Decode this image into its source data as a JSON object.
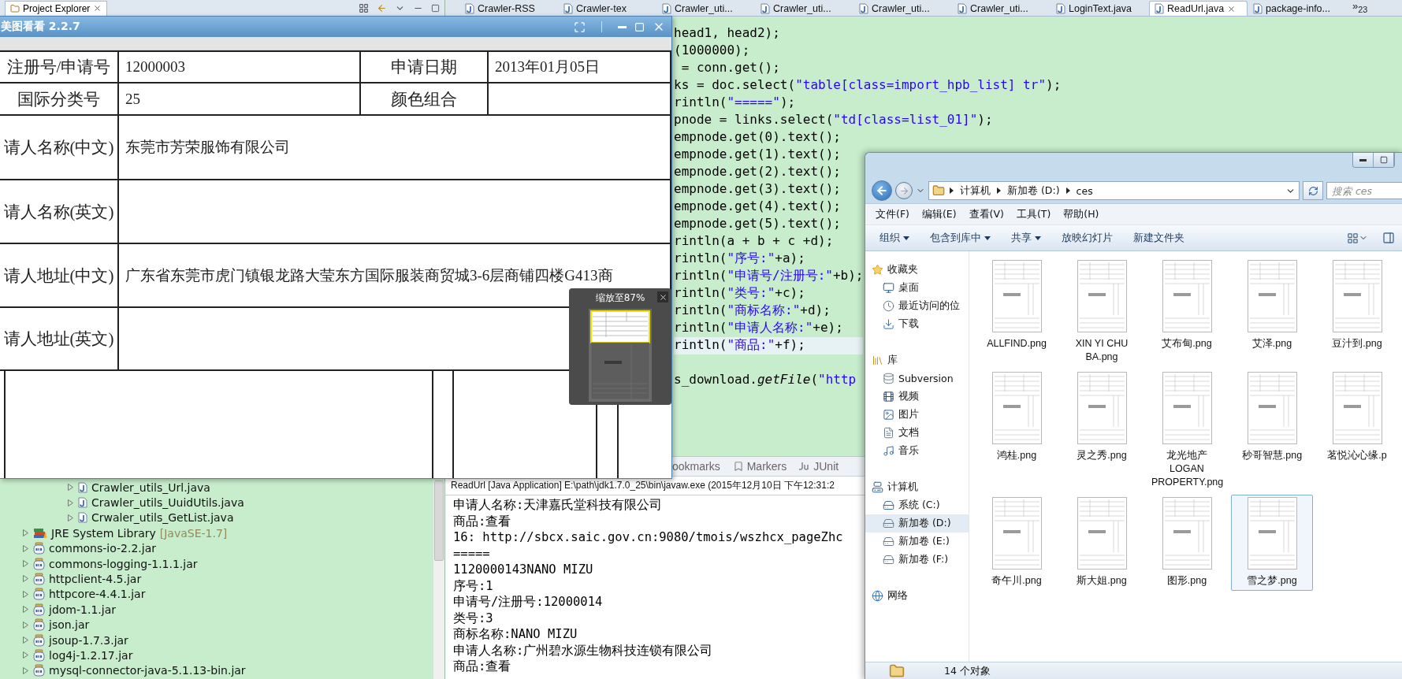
{
  "project_explorer": {
    "tab": {
      "label": "Project Explorer",
      "selected": true
    },
    "tree": [
      {
        "children": [
          {
            "label": "Crawler_utils_Url.java",
            "kind": "java",
            "expanded": false
          },
          {
            "label": "Crawler_utils_UuidUtils.java",
            "kind": "java",
            "expanded": false
          },
          {
            "label": "Crwaler_utils_GetList.java",
            "kind": "java",
            "expanded": false
          }
        ]
      },
      {
        "label": "JRE System Library",
        "decoration": "[JavaSE-1.7]",
        "kind": "library",
        "expanded": false
      },
      {
        "label": "commons-io-2.2.jar",
        "kind": "jar",
        "expanded": false
      },
      {
        "label": "commons-logging-1.1.1.jar",
        "kind": "jar",
        "expanded": false
      },
      {
        "label": "httpclient-4.5.jar",
        "kind": "jar",
        "expanded": false
      },
      {
        "label": "httpcore-4.4.1.jar",
        "kind": "jar",
        "expanded": false
      },
      {
        "label": "jdom-1.1.jar",
        "kind": "jar",
        "expanded": false
      },
      {
        "label": "json.jar",
        "kind": "jar",
        "expanded": false
      },
      {
        "label": "jsoup-1.7.3.jar",
        "kind": "jar",
        "expanded": false
      },
      {
        "label": "log4j-1.2.17.jar",
        "kind": "jar",
        "expanded": false
      },
      {
        "label": "mysql-connector-java-5.1.13-bin.jar",
        "kind": "jar",
        "expanded": false
      }
    ]
  },
  "editor": {
    "tabs": [
      {
        "label": "Crawler-RSS",
        "selected": false
      },
      {
        "label": "Crawler-tex",
        "selected": false
      },
      {
        "label": "Crawler_uti...",
        "selected": false
      },
      {
        "label": "Crawler_uti...",
        "selected": false
      },
      {
        "label": "Crawler_uti...",
        "selected": false
      },
      {
        "label": "Crawler_uti...",
        "selected": false
      },
      {
        "label": "LoginText.java",
        "selected": false
      },
      {
        "label": "ReadUrl.java",
        "selected": true
      },
      {
        "label": "package-info...",
        "selected": false
      }
    ],
    "overflow": "»$_{23}$",
    "lines": [
      {
        "kind": "code",
        "text": "head1, head2);",
        "current": false
      },
      {
        "kind": "code",
        "text": "(1000000);",
        "current": false
      },
      {
        "kind": "code",
        "text": " = conn.get();",
        "current": false
      },
      {
        "kind": "code",
        "text": "ks = doc.select(\"table[class=import_hpb_list] tr\");",
        "current": false
      },
      {
        "kind": "code",
        "text": "rintln(\"=====\");",
        "current": false
      },
      {
        "kind": "code",
        "text": "pnode = links.select(\"td[class=list_01]\");",
        "current": false
      },
      {
        "kind": "code",
        "text": "empnode.get(0).text();",
        "current": false
      },
      {
        "kind": "code",
        "text": "empnode.get(1).text();",
        "current": false
      },
      {
        "kind": "code",
        "text": "empnode.get(2).text();",
        "current": false
      },
      {
        "kind": "code",
        "text": "empnode.get(3).text();",
        "current": false
      },
      {
        "kind": "code",
        "text": "empnode.get(4).text();",
        "current": false
      },
      {
        "kind": "code",
        "text": "empnode.get(5).text();",
        "current": false
      },
      {
        "kind": "code",
        "text": "rintln(a + b + c +d);",
        "current": false
      },
      {
        "kind": "code",
        "text": "rintln(\"序号:\"+a);",
        "current": false
      },
      {
        "kind": "code",
        "text": "rintln(\"申请号/注册号:\"+b);",
        "current": false
      },
      {
        "kind": "code",
        "text": "rintln(\"类号:\"+c);",
        "current": false
      },
      {
        "kind": "code",
        "text": "rintln(\"商标名称:\"+d);",
        "current": false
      },
      {
        "kind": "code",
        "text": "rintln(\"申请人名称:\"+e);",
        "current": false
      },
      {
        "kind": "code",
        "text": "rintln(\"商品:\"+f);",
        "current": true
      },
      {
        "kind": "blank"
      },
      {
        "kind": "code",
        "text": "s_download.*getFile*(\"http",
        "current": false
      }
    ]
  },
  "console": {
    "tabs": [
      {
        "label": "ookmarks",
        "kind": "bookmarks"
      },
      {
        "label": "Markers",
        "kind": "markers"
      },
      {
        "label": "JUnit",
        "kind": "junit"
      }
    ],
    "header": "ReadUrl [Java Application] E:\\path\\jdk1.7.0_25\\bin\\javaw.exe (2015年12月10日 下午12:31:2",
    "lines": [
      "申请人名称:天津嘉氏堂科技有限公司",
      "商品:查看",
      "16: http://sbcx.saic.gov.cn:9080/tmois/wszhcx_pageZhc",
      "=====",
      "1120000143NANO MIZU",
      "序号:1",
      "申请号/注册号:12000014",
      "类号:3",
      "商标名称:NANO MIZU",
      "申请人名称:广州碧水源生物科技连锁有限公司",
      "商品:查看"
    ]
  },
  "image_viewer": {
    "title": "美图看看 2.2.7",
    "table": {
      "rows": [
        {
          "label": "注册号/申请号",
          "value": "12000003",
          "label_2": "申请日期",
          "value_2": "2013年01月05日"
        },
        {
          "label": "国际分类号",
          "value": "25",
          "label_2": "颜色组合"
        },
        {
          "label": "请人名称(中文)",
          "value": "东莞市芳荣服饰有限公司"
        },
        {
          "label": "请人名称(英文)"
        },
        {
          "label": "请人地址(中文)",
          "value": "广东省东莞市虎门镇银龙路大莹东方国际服装商贸城3-6层商铺四楼G413商"
        },
        {
          "label": "请人地址(英文)"
        }
      ]
    },
    "zoom_popup": {
      "label": "缩放至87%"
    }
  },
  "file_explorer": {
    "breadcrumbs": [
      "计算机",
      "新加卷 (D:)",
      "ces"
    ],
    "search": {
      "placeholder": "搜索 ces"
    },
    "menu": [
      "文件(F)",
      "编辑(E)",
      "查看(V)",
      "工具(T)",
      "帮助(H)"
    ],
    "commands": [
      {
        "label": "组织",
        "dropdown": true
      },
      {
        "label": "包含到库中",
        "dropdown": true
      },
      {
        "label": "共享",
        "dropdown": true
      },
      {
        "label": "放映幻灯片",
        "dropdown": false
      },
      {
        "label": "新建文件夹",
        "dropdown": false
      }
    ],
    "nav": [
      {
        "label": "收藏夹",
        "kind": "favorites",
        "selected": false,
        "children": [
          {
            "label": "桌面",
            "kind": "desktop",
            "selected": false
          },
          {
            "label": "最近访问的位",
            "kind": "recent",
            "selected": false
          },
          {
            "label": "下载",
            "kind": "downloads",
            "selected": false
          }
        ]
      },
      {
        "label": "库",
        "kind": "libraries",
        "selected": false,
        "children": [
          {
            "label": "Subversion",
            "kind": "repository",
            "selected": false
          },
          {
            "label": "视频",
            "kind": "videos",
            "selected": false
          },
          {
            "label": "图片",
            "kind": "pictures",
            "selected": false
          },
          {
            "label": "文档",
            "kind": "documents",
            "selected": false
          },
          {
            "label": "音乐",
            "kind": "music",
            "selected": false
          }
        ]
      },
      {
        "label": "计算机",
        "kind": "computer",
        "selected": false,
        "children": [
          {
            "label": "系统 (C:)",
            "kind": "system_drive",
            "selected": false
          },
          {
            "label": "新加卷 (D:)",
            "kind": "drive",
            "selected": true
          },
          {
            "label": "新加卷 (E:)",
            "kind": "drive",
            "selected": false
          },
          {
            "label": "新加卷 (F:)",
            "kind": "drive",
            "selected": false
          }
        ]
      },
      {
        "label": "网络",
        "kind": "network",
        "selected": false
      }
    ],
    "files": [
      {
        "name": "ALLFIND.png",
        "selected": false
      },
      {
        "name": "XIN YI CHU BA.png",
        "selected": false
      },
      {
        "name": "艾布甸.png",
        "selected": false
      },
      {
        "name": "艾泽.png",
        "selected": false
      },
      {
        "name": "豆汁到.png",
        "selected": false
      },
      {
        "name": "鸿桂.png",
        "selected": false
      },
      {
        "name": "灵之秀.png",
        "selected": false
      },
      {
        "name": "龙光地产 LOGAN PROPERTY.png",
        "selected": false
      },
      {
        "name": "秒哥智慧.png",
        "selected": false
      },
      {
        "name": "茗悦沁心缘.p",
        "selected": false
      },
      {
        "name": "奇午川.png",
        "selected": false
      },
      {
        "name": "斯大姐.png",
        "selected": false
      },
      {
        "name": "图形.png",
        "selected": false
      },
      {
        "name": "雪之梦.png",
        "selected": true
      }
    ],
    "status": "14 个对象"
  }
}
